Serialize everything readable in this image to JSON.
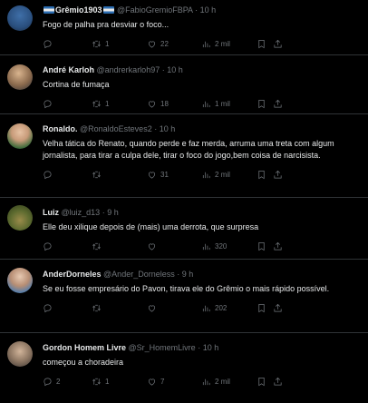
{
  "tweets": [
    {
      "name": "Grêmio1903",
      "name_has_flags": true,
      "handle": "@FabioGremioFBPA",
      "time": "10 h",
      "text": "Fogo de palha pra desviar o foco...",
      "replies": "",
      "retweets": "1",
      "likes": "22",
      "views": "2 mil"
    },
    {
      "name": "André Karloh",
      "handle": "@andrerkarloh97",
      "time": "10 h",
      "text": "Cortina de fumaça",
      "replies": "",
      "retweets": "1",
      "likes": "18",
      "views": "1 mil"
    },
    {
      "name": "Ronaldo.",
      "handle": "@RonaldoEsteves2",
      "time": "10 h",
      "text": "Velha tática do Renato, quando perde e faz merda, arruma uma treta com algum jornalista, para tirar a culpa dele, tirar o foco do jogo,bem coisa de narcisista.",
      "replies": "",
      "retweets": "",
      "likes": "31",
      "views": "2 mil"
    },
    {
      "name": "Luiz",
      "handle": "@luiz_d13",
      "time": "9 h",
      "text": "Elle deu xilique depois de (mais) uma derrota, que surpresa",
      "replies": "",
      "retweets": "",
      "likes": "",
      "views": "320"
    },
    {
      "name": "AnderDorneles",
      "handle": "@Ander_Dorneless",
      "time": "9 h",
      "text": "Se eu fosse empresário do Pavon, tirava ele do Grêmio o mais rápido possível.",
      "replies": "",
      "retweets": "",
      "likes": "",
      "views": "202"
    },
    {
      "name": "Gordon Homem Livre",
      "handle": "@Sr_HomemLivre",
      "time": "10 h",
      "text": "começou a choradeira",
      "replies": "2",
      "retweets": "1",
      "likes": "7",
      "views": "2 mil"
    }
  ],
  "colors": {
    "background": "#000000",
    "text": "#e7e9ea",
    "secondary": "#71767b",
    "divider": "#2f3336"
  }
}
